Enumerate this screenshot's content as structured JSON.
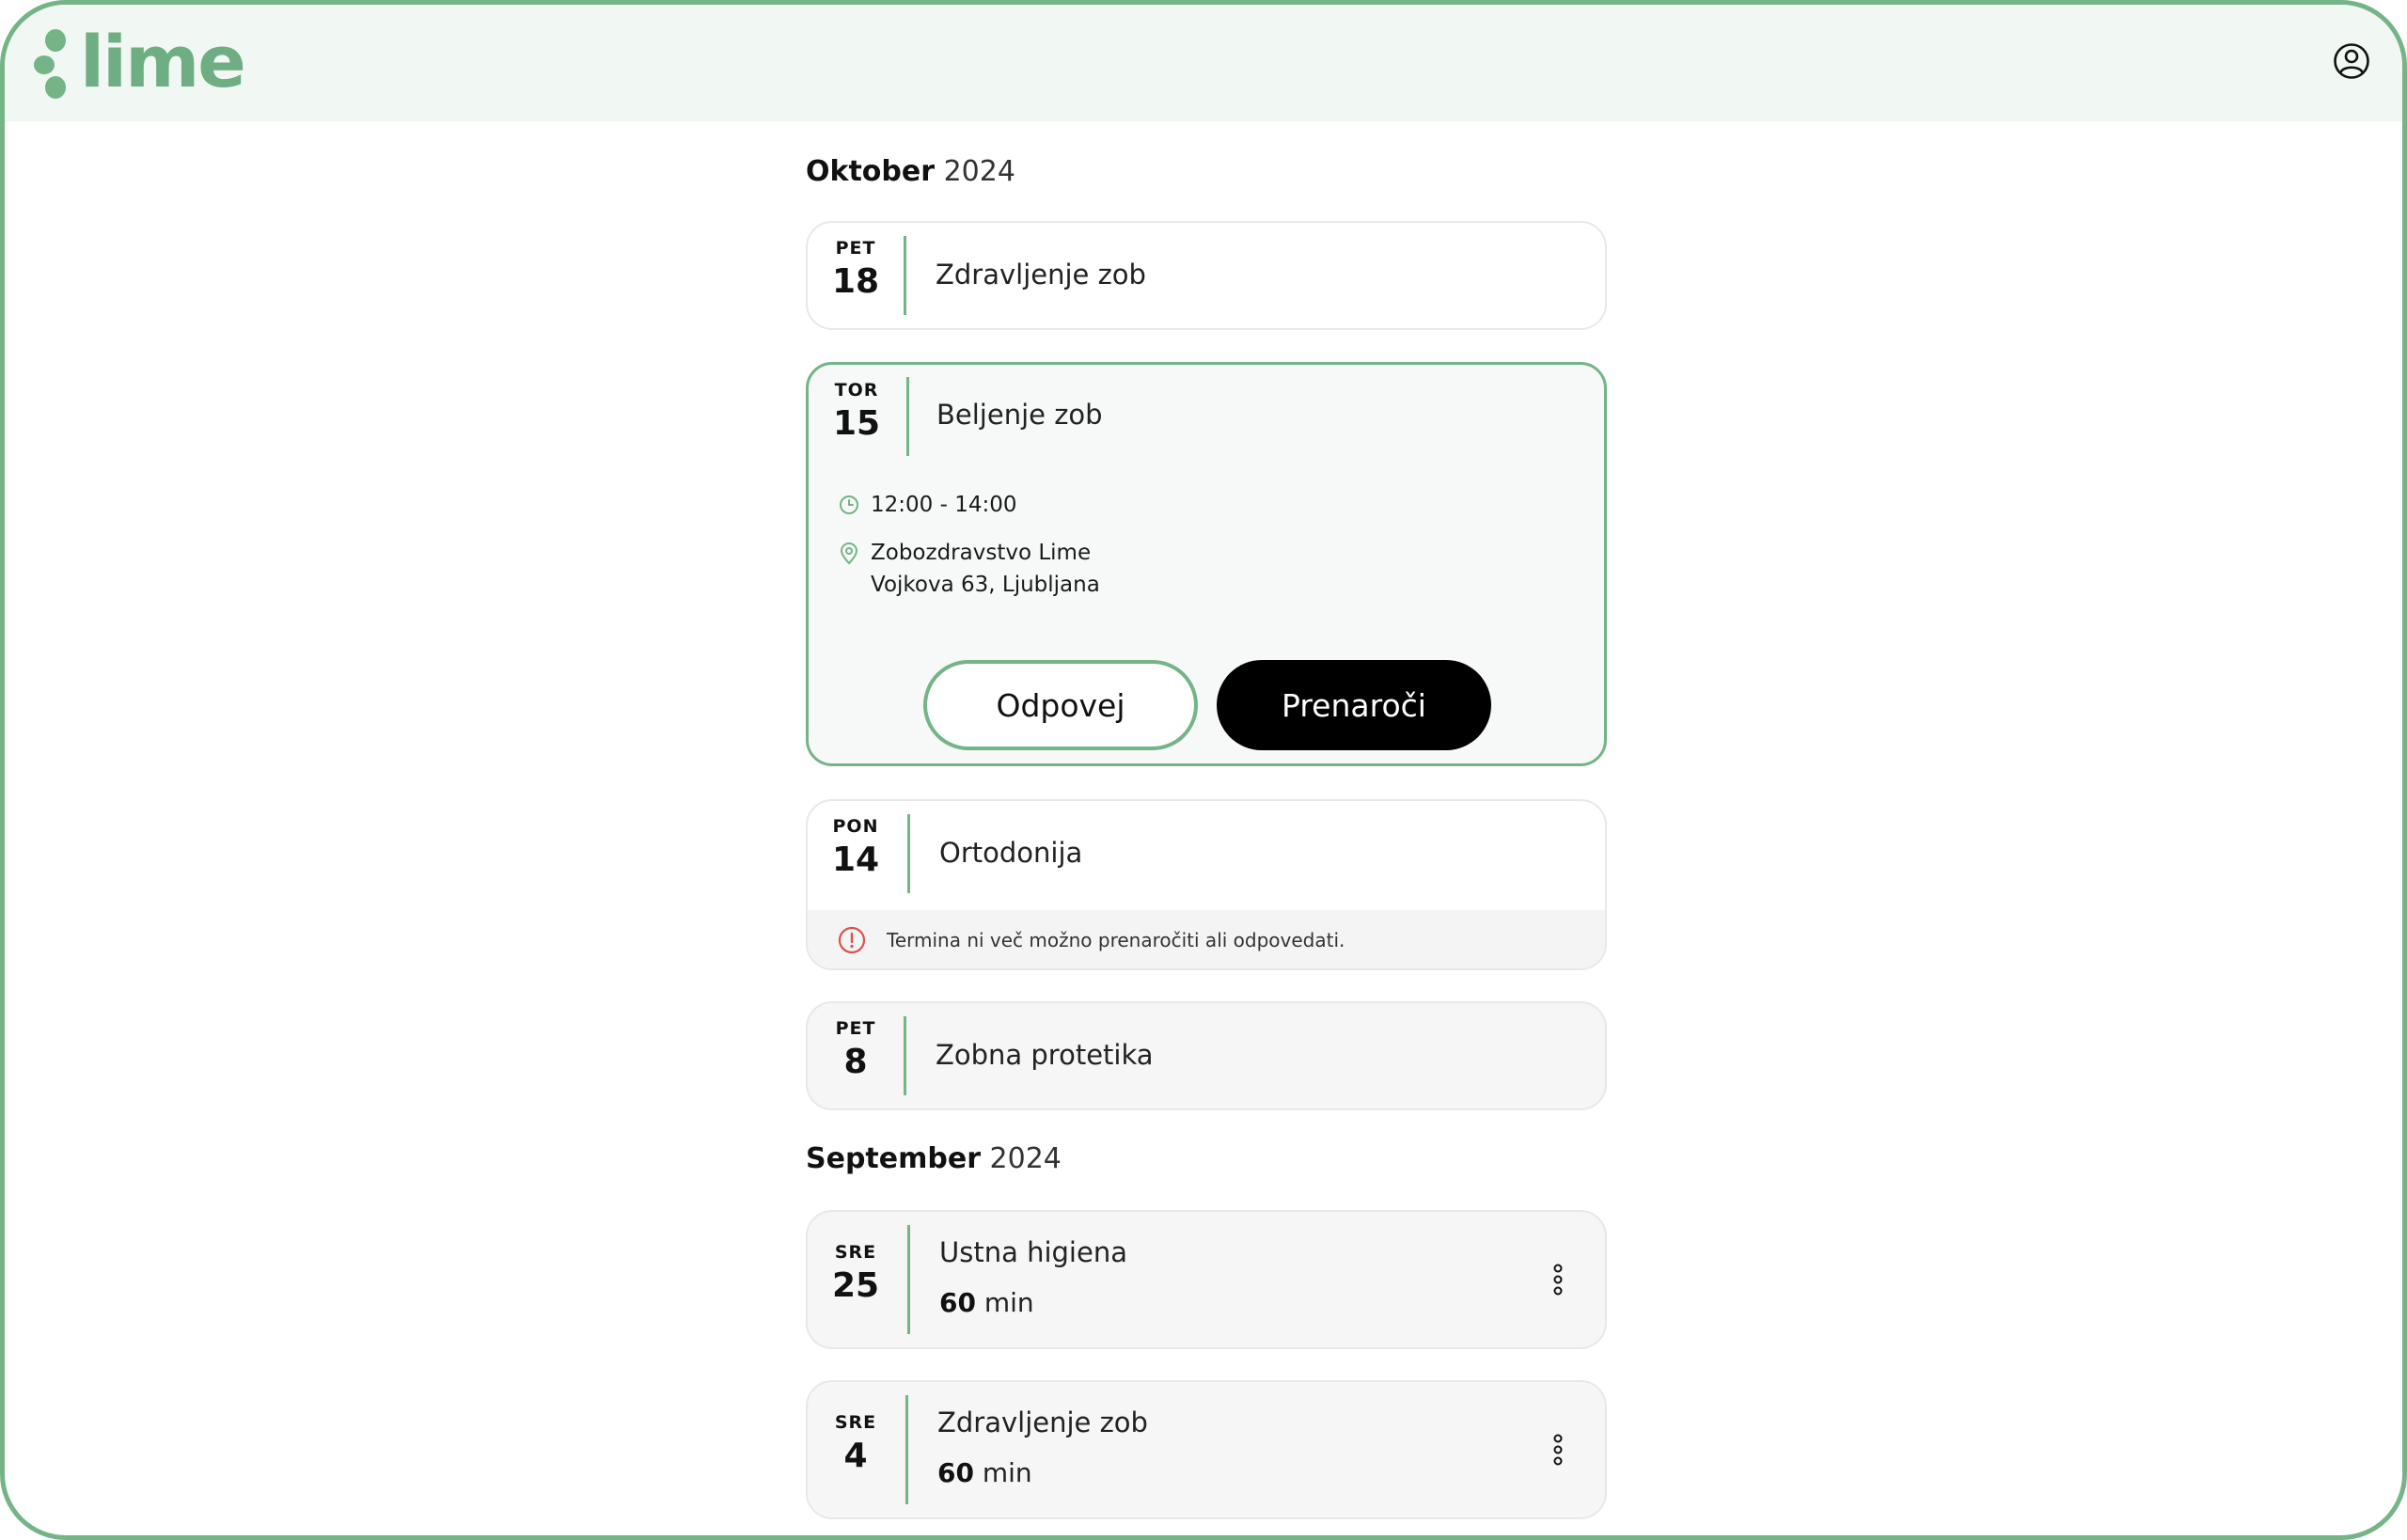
{
  "app": {
    "logo_text": "lime",
    "colors": {
      "accent": "#74b487",
      "primary_button": "#000000",
      "error": "#d9534f"
    }
  },
  "header": {
    "user_icon": "user-circle-icon"
  },
  "groups": [
    {
      "month": "Oktober",
      "year": "2024",
      "appointments": [
        {
          "dow": "PET",
          "day": "18",
          "title": "Zdravljenje zob"
        },
        {
          "dow": "TOR",
          "day": "15",
          "title": "Beljenje zob",
          "time": "12:00 - 14:00",
          "location_name": "Zobozdravstvo Lime",
          "location_address": "Vojkova 63, Ljubljana",
          "cancel_label": "Odpovej",
          "reschedule_label": "Prenaroči"
        },
        {
          "dow": "PON",
          "day": "14",
          "title": "Ortodonija",
          "warning": "Termina ni več možno prenaročiti ali odpovedati."
        },
        {
          "dow": "PET",
          "day": "8",
          "title": "Zobna protetika"
        }
      ]
    },
    {
      "month": "September",
      "year": "2024",
      "appointments": [
        {
          "dow": "SRE",
          "day": "25",
          "title": "Ustna higiena",
          "duration_value": "60",
          "duration_unit": "min"
        },
        {
          "dow": "SRE",
          "day": "4",
          "title": "Zdravljenje zob",
          "duration_value": "60",
          "duration_unit": "min"
        }
      ]
    }
  ]
}
